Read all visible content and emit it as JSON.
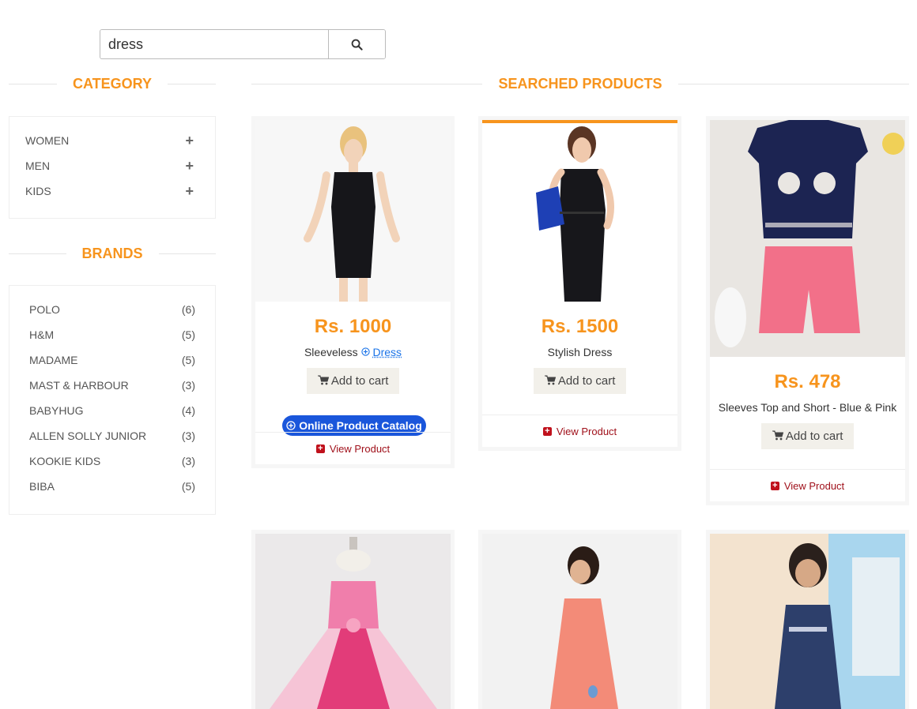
{
  "search": {
    "value": "dress",
    "button_icon": "search-icon"
  },
  "category": {
    "title": "CATEGORY",
    "items": [
      {
        "label": "WOMEN",
        "icon": "+"
      },
      {
        "label": "MEN",
        "icon": "+"
      },
      {
        "label": "KIDS",
        "icon": "+"
      }
    ]
  },
  "brands": {
    "title": "BRANDS",
    "items": [
      {
        "label": "POLO",
        "count": "(6)"
      },
      {
        "label": "H&M",
        "count": "(5)"
      },
      {
        "label": "MADAME",
        "count": "(5)"
      },
      {
        "label": "MAST & HARBOUR",
        "count": "(3)"
      },
      {
        "label": "BABYHUG",
        "count": "(4)"
      },
      {
        "label": "ALLEN SOLLY JUNIOR",
        "count": "(3)"
      },
      {
        "label": "KOOKIE KIDS",
        "count": "(3)"
      },
      {
        "label": "BIBA",
        "count": "(5)"
      }
    ]
  },
  "products": {
    "title": "SEARCHED PRODUCTS",
    "cart_label": "Add to cart",
    "view_label": "View Product",
    "catalog_label": "Online Product Catalog",
    "items": [
      {
        "price": "Rs. 1000",
        "name": "Sleeveless",
        "link_word": "Dress"
      },
      {
        "price": "Rs. 1500",
        "name": "Stylish Dress"
      },
      {
        "price": "Rs. 478",
        "name": "Sleeves Top and Short - Blue & Pink"
      }
    ]
  },
  "colors": {
    "accent": "#f7941d",
    "link": "#1a73e8",
    "catalog": "#1a56db",
    "view": "#a0111b"
  }
}
